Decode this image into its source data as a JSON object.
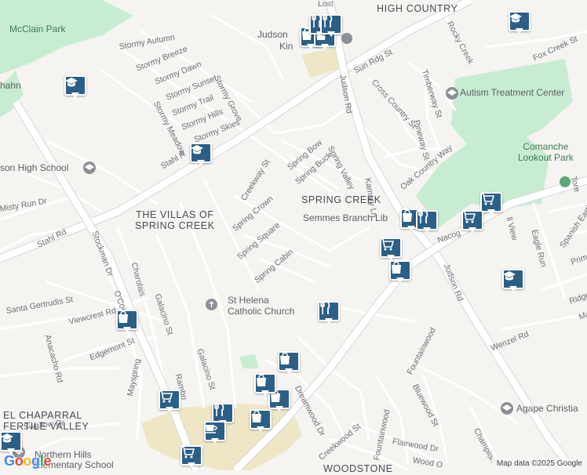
{
  "areas": [
    {
      "id": "high-country",
      "text": "HIGH COUNTRY"
    },
    {
      "id": "spring-creek",
      "text": "SPRING CREEK"
    },
    {
      "id": "villas",
      "text": "THE VILLAS OF\nSPRING CREEK"
    },
    {
      "id": "el-chaparral",
      "text": "EL CHAPARRAL\nFERTILE VALLEY"
    },
    {
      "id": "woodstone",
      "text": "WOODSTONE"
    }
  ],
  "parks": [
    {
      "id": "mcclain",
      "text": "McClain Park"
    },
    {
      "id": "comanche",
      "text": "Comanche\nLookout Park"
    }
  ],
  "pois": [
    {
      "id": "judson-high",
      "text": "son High School"
    },
    {
      "id": "st-helena",
      "text": "St Helena\nCatholic Church"
    },
    {
      "id": "semmes",
      "text": "Semmes Branch Lib"
    },
    {
      "id": "autism",
      "text": "Autism Treatment Center"
    },
    {
      "id": "northern-hills",
      "text": "Northern Hills\nElementary School"
    },
    {
      "id": "agape",
      "text": "Agape Christia"
    },
    {
      "id": "judson-top",
      "text": "Judson"
    },
    {
      "id": "kin",
      "text": "Kin"
    },
    {
      "id": "hahn",
      "text": "hahn"
    }
  ],
  "streets": [
    {
      "id": "lost",
      "text": "Lost"
    },
    {
      "id": "rocky-creek",
      "text": "Rocky Creek"
    },
    {
      "id": "fox-creek",
      "text": "Fox Creek St"
    },
    {
      "id": "sun-rdg",
      "text": "Sun Rdg St"
    },
    {
      "id": "judson-rd-1",
      "text": "Judson Rd"
    },
    {
      "id": "judson-rd-2",
      "text": "Judson Rd"
    },
    {
      "id": "cross-country",
      "text": "Cross Country St"
    },
    {
      "id": "timberway",
      "text": "Timberway St"
    },
    {
      "id": "pineway",
      "text": "Pineway St"
    },
    {
      "id": "oak-country",
      "text": "Oak Country Way"
    },
    {
      "id": "stormy-autumn",
      "text": "Stormy Autumn"
    },
    {
      "id": "stormy-breeze",
      "text": "Stormy Breeze"
    },
    {
      "id": "stormy-dawn",
      "text": "Stormy Dawn"
    },
    {
      "id": "stormy-sunset",
      "text": "Stormy Sunset"
    },
    {
      "id": "stormy-trail",
      "text": "Stormy Trail"
    },
    {
      "id": "stormy-hills",
      "text": "Stormy Hills"
    },
    {
      "id": "stormy-skies",
      "text": "Stormy Skies"
    },
    {
      "id": "stormy-meadow",
      "text": "Stormy Meadow"
    },
    {
      "id": "stormy-grove",
      "text": "Stormy Grove"
    },
    {
      "id": "stahl-rd-1",
      "text": "Stahl R"
    },
    {
      "id": "stahl-rd-2",
      "text": "Stahl Rd"
    },
    {
      "id": "creekway",
      "text": "Creekway St"
    },
    {
      "id": "spring-bow",
      "text": "Spring Bow"
    },
    {
      "id": "spring-buck",
      "text": "Spring Buck"
    },
    {
      "id": "spring-valley",
      "text": "Spring Valley"
    },
    {
      "id": "spring-crown",
      "text": "Spring Crown"
    },
    {
      "id": "spring-square",
      "text": "Spring Square"
    },
    {
      "id": "spring-cabin",
      "text": "Spring Cabin"
    },
    {
      "id": "kamary",
      "text": "Kamary Ln"
    },
    {
      "id": "misty-run",
      "text": "Misty Run Dr"
    },
    {
      "id": "stockman",
      "text": "Stockman Dr"
    },
    {
      "id": "charolais",
      "text": "Charolais"
    },
    {
      "id": "galacino-1",
      "text": "Galacino St"
    },
    {
      "id": "galacino-2",
      "text": "Galacino St"
    },
    {
      "id": "santa-gertrudis",
      "text": "Santa Gertrudis St"
    },
    {
      "id": "viewcrest",
      "text": "Viewcrest Rd"
    },
    {
      "id": "anacacho",
      "text": "Anacacho Rd"
    },
    {
      "id": "o-connor",
      "text": "O'Con"
    },
    {
      "id": "edgemont",
      "text": "Edgemont St"
    },
    {
      "id": "rambo",
      "text": "Rambo"
    },
    {
      "id": "mayspring",
      "text": "Mayspring"
    },
    {
      "id": "swallow",
      "text": "Swallow Dr"
    },
    {
      "id": "dreamwood",
      "text": "Dreamwood Dr"
    },
    {
      "id": "creekwood",
      "text": "Creekwood St"
    },
    {
      "id": "fountainwood-1",
      "text": "Fountainwood"
    },
    {
      "id": "fountainwood-2",
      "text": "Fountainwood"
    },
    {
      "id": "bluewood",
      "text": "Bluewood St"
    },
    {
      "id": "flairwood",
      "text": "Flairwood Dr"
    },
    {
      "id": "wood-o",
      "text": "Wood O"
    },
    {
      "id": "champion",
      "text": "Champion"
    },
    {
      "id": "wenzel",
      "text": "Wenzel Rd"
    },
    {
      "id": "eagle-run",
      "text": "Eagle Run"
    },
    {
      "id": "spanish-earth",
      "text": "Spanish Earth"
    },
    {
      "id": "nacog",
      "text": "Nacog"
    },
    {
      "id": "hill-view",
      "text": "ll View"
    },
    {
      "id": "tore",
      "text": "Tore"
    },
    {
      "id": "prim",
      "text": "Prim"
    },
    {
      "id": "ridge",
      "text": "Ridge"
    },
    {
      "id": "ma",
      "text": "Ma"
    }
  ],
  "markers": [
    {
      "id": "m1",
      "icon": "shopping-bag",
      "label": "shop"
    },
    {
      "id": "m2",
      "icon": "shopping-bag",
      "label": "shop"
    },
    {
      "id": "m3",
      "icon": "school",
      "label": "school"
    },
    {
      "id": "m4",
      "icon": "school",
      "label": "school"
    },
    {
      "id": "m5",
      "icon": "school",
      "label": "school"
    },
    {
      "id": "m6",
      "icon": "restaurant",
      "label": "restaurant"
    },
    {
      "id": "m7",
      "icon": "restaurant",
      "label": "restaurant"
    },
    {
      "id": "m8",
      "icon": "shopping-cart",
      "label": "grocery"
    },
    {
      "id": "m9",
      "icon": "shopping-cart",
      "label": "grocery"
    },
    {
      "id": "m10",
      "icon": "shopping-cart",
      "label": "grocery"
    },
    {
      "id": "m11",
      "icon": "shopping-bag",
      "label": "shop"
    },
    {
      "id": "m12",
      "icon": "shopping-bag",
      "label": "shop"
    },
    {
      "id": "m13",
      "icon": "school",
      "label": "school"
    },
    {
      "id": "m14",
      "icon": "restaurant",
      "label": "restaurant"
    },
    {
      "id": "m15",
      "icon": "shopping-bag",
      "label": "shop"
    },
    {
      "id": "m16",
      "icon": "shopping-bag",
      "label": "shop"
    },
    {
      "id": "m17",
      "icon": "shopping-cart",
      "label": "grocery"
    },
    {
      "id": "m18",
      "icon": "shopping-bag",
      "label": "shop"
    },
    {
      "id": "m19",
      "icon": "restaurant",
      "label": "restaurant"
    },
    {
      "id": "m20",
      "icon": "shopping-bag",
      "label": "shop"
    },
    {
      "id": "m21",
      "icon": "cafe",
      "label": "cafe"
    },
    {
      "id": "m22",
      "icon": "shopping-cart",
      "label": "grocery"
    },
    {
      "id": "m23",
      "icon": "school",
      "label": "school"
    },
    {
      "id": "m24",
      "icon": "shopping-bag",
      "label": "shop"
    },
    {
      "id": "m25",
      "icon": "restaurant",
      "label": "restaurant"
    }
  ],
  "footer": {
    "google": "Google",
    "attribution": "Map data ©2025 Google"
  },
  "colors": {
    "marker": "#2b5f86",
    "park": "#c8ecd1",
    "background": "#f5f4f1"
  }
}
